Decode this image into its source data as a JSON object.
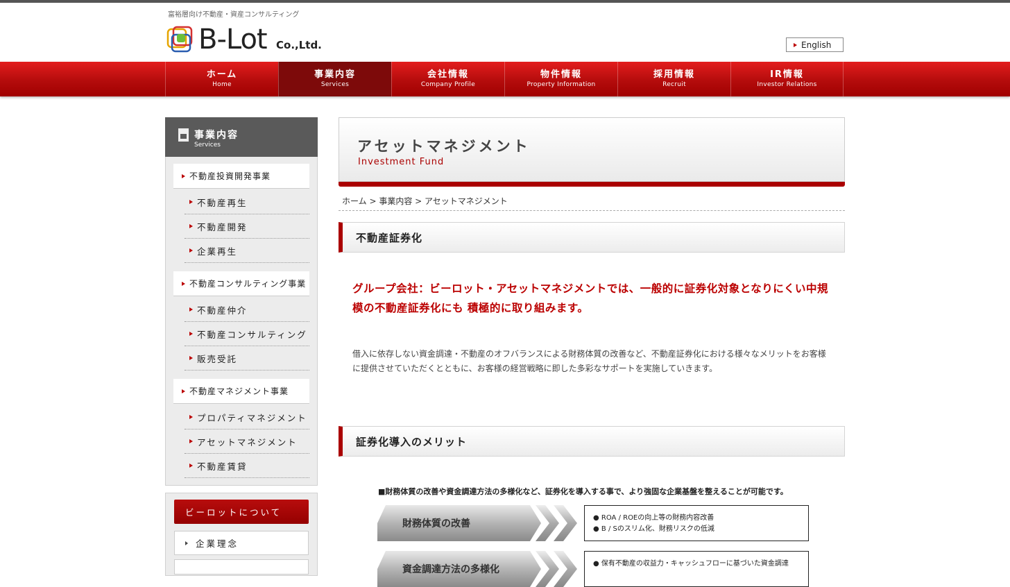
{
  "header": {
    "tagline": "富裕層向け不動産・資産コンサルティング",
    "logo_main": "B-Lot",
    "logo_sub": "Co.,Ltd.",
    "english_label": "English"
  },
  "nav": [
    {
      "jp": "ホーム",
      "en": "Home"
    },
    {
      "jp": "事業内容",
      "en": "Services"
    },
    {
      "jp": "会社情報",
      "en": "Company Profile"
    },
    {
      "jp": "物件情報",
      "en": "Property Information"
    },
    {
      "jp": "採用情報",
      "en": "Recruit"
    },
    {
      "jp": "IR情報",
      "en": "Investor Relations"
    }
  ],
  "sidebar": {
    "title_jp": "事業内容",
    "title_en": "Services",
    "groups": [
      {
        "label": "不動産投資開発事業",
        "items": [
          "不動産再生",
          "不動産開発",
          "企業再生"
        ]
      },
      {
        "label": "不動産コンサルティング事業",
        "items": [
          "不動産仲介",
          "不動産コンサルティング",
          "販売受託"
        ]
      },
      {
        "label": "不動産マネジメント事業",
        "items": [
          "プロパティマネジメント",
          "アセットマネジメント",
          "不動産賃貸"
        ]
      }
    ],
    "about_title": "ビーロットについて",
    "about_items": [
      "企業理念"
    ]
  },
  "main": {
    "title_jp": "アセットマネジメント",
    "title_en": "Investment Fund",
    "breadcrumb": [
      "ホーム",
      "事業内容",
      "アセットマネジメント"
    ],
    "breadcrumb_sep": " > ",
    "section1": "不動産証券化",
    "lead": "グループ会社：ビーロット・アセットマネジメントでは、一般的に証券化対象となりにくい中規模の不動産証券化にも 積極的に取り組みます。",
    "body": "借入に依存しない資金調達・不動産のオフバランスによる財務体質の改善など、不動産証券化における様々なメリットをお客様に提供させていただくとともに、お客様の経営戦略に即した多彩なサポートを実施していきます。",
    "section2": "証券化導入のメリット",
    "merit_lead": "■財務体質の改善や資金調達方法の多様化など、証券化を導入する事で、より強固な企業基盤を整えることが可能です。",
    "merits": [
      {
        "title": "財務体質の改善",
        "points": [
          "● ROA / ROEの向上等の財務内容改善",
          "● B / Sのスリム化、財務リスクの低減"
        ]
      },
      {
        "title": "資金調達方法の多様化",
        "points": [
          "● 保有不動産の収益力・キャッシュフローに基づいた資金調達"
        ]
      }
    ]
  },
  "colors": {
    "accent": "#a00000",
    "nav_active": "#7d0a0a"
  }
}
